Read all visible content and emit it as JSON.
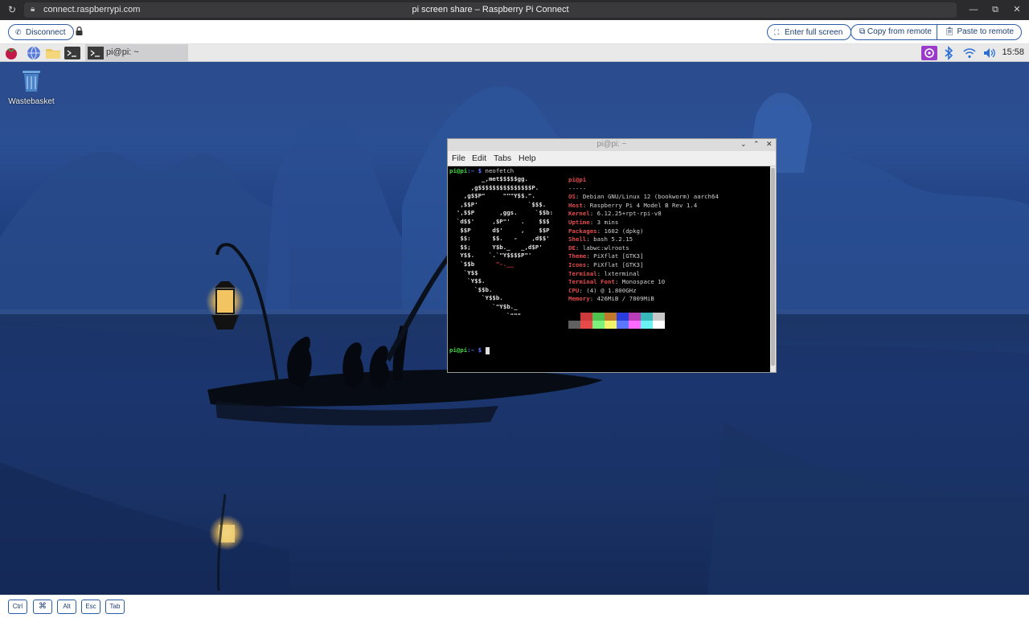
{
  "browser": {
    "url": "connect.raspberrypi.com",
    "title": "pi screen share – Raspberry Pi Connect"
  },
  "toolbar": {
    "disconnect": "Disconnect",
    "enter_full_screen": "Enter full screen",
    "copy_from_remote": "Copy from remote",
    "paste_to_remote": "Paste to remote"
  },
  "desktop": {
    "taskbar_window": "pi@pi: ~",
    "clock": "15:58",
    "wastebasket": "Wastebasket"
  },
  "terminal": {
    "title": "pi@pi: ~",
    "menu": [
      "File",
      "Edit",
      "Tabs",
      "Help"
    ],
    "prompt_user": "pi@pi",
    "prompt_path": ":~ $",
    "command": " neofetch",
    "user_host": "pi@pi",
    "separator": "-----",
    "info": [
      {
        "key": "OS",
        "value": "Debian GNU/Linux 12 (bookworm) aarch64"
      },
      {
        "key": "Host",
        "value": "Raspberry Pi 4 Model B Rev 1.4"
      },
      {
        "key": "Kernel",
        "value": "6.12.25+rpt-rpi-v8"
      },
      {
        "key": "Uptime",
        "value": "3 mins"
      },
      {
        "key": "Packages",
        "value": "1602 (dpkg)"
      },
      {
        "key": "Shell",
        "value": "bash 5.2.15"
      },
      {
        "key": "DE",
        "value": "labwc:wlroots"
      },
      {
        "key": "Theme",
        "value": "PiXflat [GTK3]"
      },
      {
        "key": "Icons",
        "value": "PiXflat [GTK3]"
      },
      {
        "key": "Terminal",
        "value": "lxterminal"
      },
      {
        "key": "Terminal Font",
        "value": "Monospace 10"
      },
      {
        "key": "CPU",
        "value": "(4) @ 1.800GHz"
      },
      {
        "key": "Memory",
        "value": "426MiB / 7809MiB"
      }
    ],
    "colors_top": [
      "#000000",
      "#cc3b3b",
      "#4ec24e",
      "#c0782a",
      "#2a3ee0",
      "#b83eb8",
      "#38b8b8",
      "#c8c8c8"
    ],
    "colors_bottom": [
      "#606060",
      "#e84a4a",
      "#7cf27c",
      "#f2f26a",
      "#5a78ff",
      "#ff6aff",
      "#6af2f2",
      "#ffffff"
    ]
  },
  "keys": [
    "Ctrl",
    "⌘",
    "Alt",
    "Esc",
    "Tab"
  ]
}
